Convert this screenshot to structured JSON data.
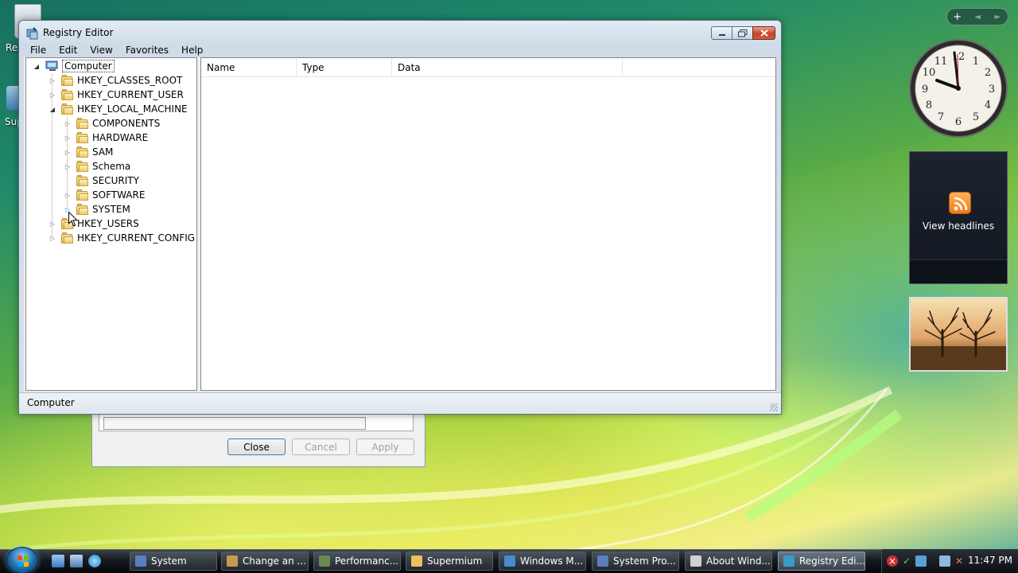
{
  "desktop": {
    "icons": [
      {
        "label": "Rec"
      },
      {
        "label": "Sup"
      }
    ]
  },
  "background_dialog": {
    "close_label": "Close",
    "cancel_label": "Cancel",
    "apply_label": "Apply"
  },
  "window": {
    "title": "Registry Editor",
    "menu": [
      "File",
      "Edit",
      "View",
      "Favorites",
      "Help"
    ],
    "tree": {
      "root": "Computer",
      "hives": [
        {
          "label": "HKEY_CLASSES_ROOT"
        },
        {
          "label": "HKEY_CURRENT_USER"
        },
        {
          "label": "HKEY_LOCAL_MACHINE",
          "children": [
            "COMPONENTS",
            "HARDWARE",
            "SAM",
            "Schema",
            "SECURITY",
            "SOFTWARE",
            "SYSTEM"
          ]
        },
        {
          "label": "HKEY_USERS"
        },
        {
          "label": "HKEY_CURRENT_CONFIG"
        }
      ]
    },
    "columns": [
      "Name",
      "Type",
      "Data"
    ],
    "status": "Computer"
  },
  "sidebar": {
    "add_label": "+",
    "prev_label": "◄",
    "next_label": "►",
    "clock_numbers": [
      "12",
      "1",
      "2",
      "3",
      "4",
      "5",
      "6",
      "7",
      "8",
      "9",
      "10",
      "11"
    ],
    "feed_text": "View headlines"
  },
  "taskbar": {
    "buttons": [
      {
        "label": "System",
        "color": "#5a7fc0"
      },
      {
        "label": "Change an ...",
        "color": "#c89a50"
      },
      {
        "label": "Performanc...",
        "color": "#6a8a50"
      },
      {
        "label": "Supermium",
        "color": "#e8c25a"
      },
      {
        "label": "Windows M...",
        "color": "#4a8ad0"
      },
      {
        "label": "System Pro...",
        "color": "#5a7fc0"
      },
      {
        "label": "About Wind...",
        "color": "#d0d0d0"
      },
      {
        "label": "Registry Edi...",
        "color": "#3a9ac8"
      }
    ],
    "time": "11:47 PM"
  }
}
